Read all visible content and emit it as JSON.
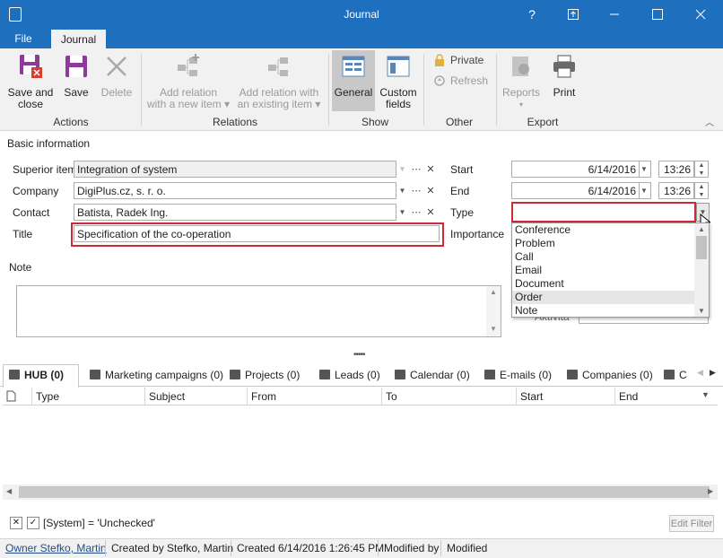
{
  "window": {
    "title": "Journal",
    "controls": {
      "help": "?",
      "restore": "⧉",
      "minimize": "—",
      "maximize": "☐",
      "close": "✕"
    }
  },
  "menu": {
    "file": "File",
    "journal": "Journal"
  },
  "ribbon": {
    "actions": {
      "label": "Actions",
      "save_close": [
        "Save and",
        "close"
      ],
      "save": "Save",
      "delete": "Delete"
    },
    "relations": {
      "label": "Relations",
      "add_new": [
        "Add relation",
        "with a new item ▾"
      ],
      "add_existing": [
        "Add relation with",
        "an existing item ▾"
      ]
    },
    "show": {
      "label": "Show",
      "general": "General",
      "custom": [
        "Custom",
        "fields"
      ]
    },
    "other": {
      "label": "Other",
      "private": "Private",
      "refresh": "Refresh"
    },
    "export": {
      "label": "Export",
      "reports": "Reports",
      "print": "Print"
    }
  },
  "form": {
    "section": "Basic information",
    "superior_label": "Superior item",
    "superior_value": "Integration of system",
    "company_label": "Company",
    "company_value": "DigiPlus.cz, s. r. o.",
    "contact_label": "Contact",
    "contact_value": "Batista, Radek Ing.",
    "title_label": "Title",
    "title_value": "Specification of the co-operation",
    "note_label": "Note",
    "start_label": "Start",
    "start_date": "6/14/2016",
    "start_time": "13:26",
    "end_label": "End",
    "end_date": "6/14/2016",
    "end_time": "13:26",
    "type_label": "Type",
    "type_value": "",
    "importance_label": "Importance",
    "hidden_label": "Aktivita"
  },
  "type_dropdown": {
    "options": [
      "Conference",
      "Problem",
      "Call",
      "Email",
      "Document",
      "Order",
      "Note"
    ],
    "selected": "Order"
  },
  "tabs": [
    {
      "label": "HUB (0)",
      "icon": "hub-icon"
    },
    {
      "label": "Marketing campaigns (0)",
      "icon": "megaphone-icon"
    },
    {
      "label": "Projects (0)",
      "icon": "projects-icon"
    },
    {
      "label": "Leads (0)",
      "icon": "leads-icon"
    },
    {
      "label": "Calendar (0)",
      "icon": "calendar-icon"
    },
    {
      "label": "E-mails (0)",
      "icon": "email-icon"
    },
    {
      "label": "Companies (0)",
      "icon": "companies-icon"
    },
    {
      "label": "C",
      "icon": "contacts-icon"
    }
  ],
  "grid": {
    "columns": [
      "Type",
      "Subject",
      "From",
      "To",
      "Start",
      "End"
    ]
  },
  "filter": {
    "text": "[System] = 'Unchecked'",
    "edit_button": "Edit Filter"
  },
  "status": {
    "owner": "Owner Stefko, Martin",
    "created_by": "Created by Stefko, Martin",
    "created": "Created 6/14/2016 1:26:45 PM",
    "modified_by": "Modified by",
    "modified": "Modified"
  },
  "colors": {
    "accent": "#1f6fbf",
    "error": "#cc2a36"
  }
}
